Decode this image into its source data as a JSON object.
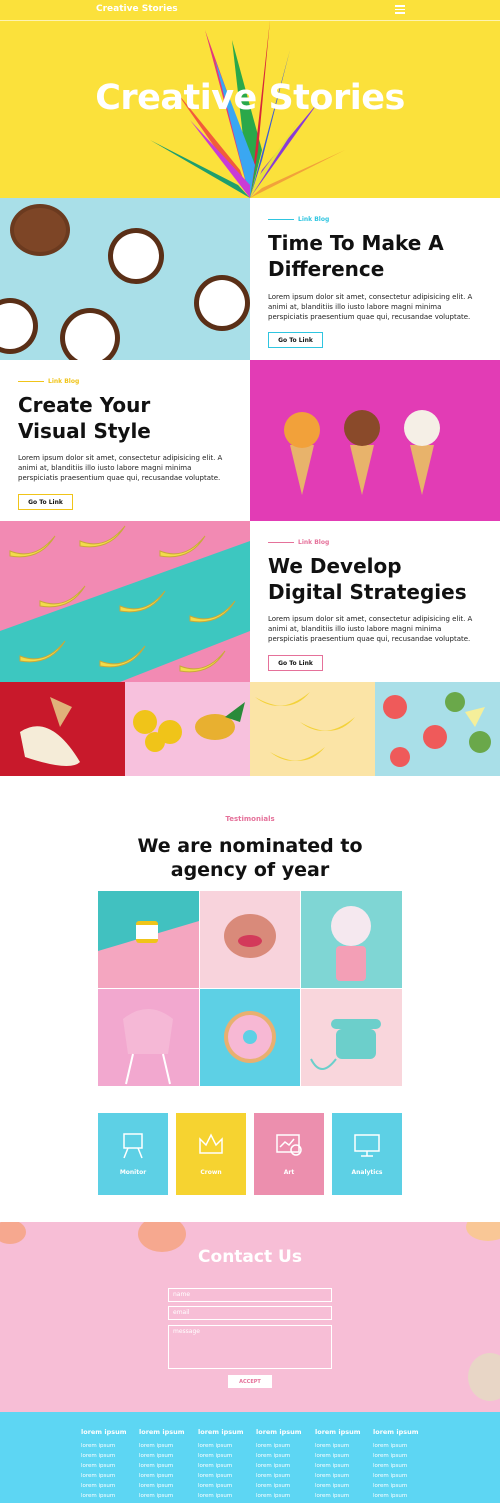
{
  "header": {
    "brand": "Creative Stories"
  },
  "hero": {
    "title": "Creative Stories"
  },
  "blocks": [
    {
      "tag": "Link Blog",
      "title_line1": "Time To Make A",
      "title_line2": "Difference",
      "body": "Lorem ipsum dolor sit amet, consectetur adipisicing elit. A animi at, blanditiis illo iusto labore magni minima perspiciatis praesentium quae qui, recusandae voluptate.",
      "button": "Go To Link"
    },
    {
      "tag": "Link Blog",
      "title_line1": "Create Your",
      "title_line2": "Visual Style",
      "body": "Lorem ipsum dolor sit amet, consectetur adipisicing elit. A animi at, blanditiis illo iusto labore magni minima perspiciatis praesentium quae qui, recusandae voluptate.",
      "button": "Go To Link"
    },
    {
      "tag": "Link Blog",
      "title_line1": "We Develop",
      "title_line2": "Digital Strategies",
      "body": "Lorem ipsum dolor sit amet, consectetur adipisicing elit. A animi at, blanditiis illo iusto labore magni minima perspiciatis praesentium quae qui, recusandae voluptate.",
      "button": "Go To Link"
    }
  ],
  "testimonials": {
    "tag": "Testimonials",
    "title_line1": "We are nominated to",
    "title_line2": "agency of year"
  },
  "services": [
    {
      "label": "Monitor",
      "icon": "easel-icon",
      "color": "#5dd0e5"
    },
    {
      "label": "Crown",
      "icon": "crown-icon",
      "color": "#f6d330"
    },
    {
      "label": "Art",
      "icon": "art-icon",
      "color": "#ec8fae"
    },
    {
      "label": "Analytics",
      "icon": "monitor-icon",
      "color": "#5dd0e5"
    }
  ],
  "contact": {
    "title": "Contact Us",
    "name_placeholder": "name",
    "email_placeholder": "email",
    "message_placeholder": "message",
    "button": "ACCEPT"
  },
  "footer": {
    "columns": [
      {
        "head": "lorem ipsum",
        "items": [
          "lorem ipsum",
          "lorem ipsum",
          "lorem ipsum",
          "lorem ipsum",
          "lorem ipsum",
          "lorem ipsum"
        ]
      },
      {
        "head": "lorem ipsum",
        "items": [
          "lorem ipsum",
          "lorem ipsum",
          "lorem ipsum",
          "lorem ipsum",
          "lorem ipsum",
          "lorem ipsum"
        ]
      },
      {
        "head": "lorem ipsum",
        "items": [
          "lorem ipsum",
          "lorem ipsum",
          "lorem ipsum",
          "lorem ipsum",
          "lorem ipsum",
          "lorem ipsum"
        ]
      },
      {
        "head": "lorem ipsum",
        "items": [
          "lorem ipsum",
          "lorem ipsum",
          "lorem ipsum",
          "lorem ipsum",
          "lorem ipsum",
          "lorem ipsum"
        ]
      },
      {
        "head": "lorem ipsum",
        "items": [
          "lorem ipsum",
          "lorem ipsum",
          "lorem ipsum",
          "lorem ipsum",
          "lorem ipsum",
          "lorem ipsum"
        ]
      },
      {
        "head": "lorem ipsum",
        "items": [
          "lorem ipsum",
          "lorem ipsum",
          "lorem ipsum",
          "lorem ipsum",
          "lorem ipsum",
          "lorem ipsum"
        ]
      }
    ]
  },
  "colors": {
    "yellow": "#fbe13b",
    "cyan": "#2fc5e0",
    "pink": "#e5719a",
    "gold": "#f0c419"
  }
}
